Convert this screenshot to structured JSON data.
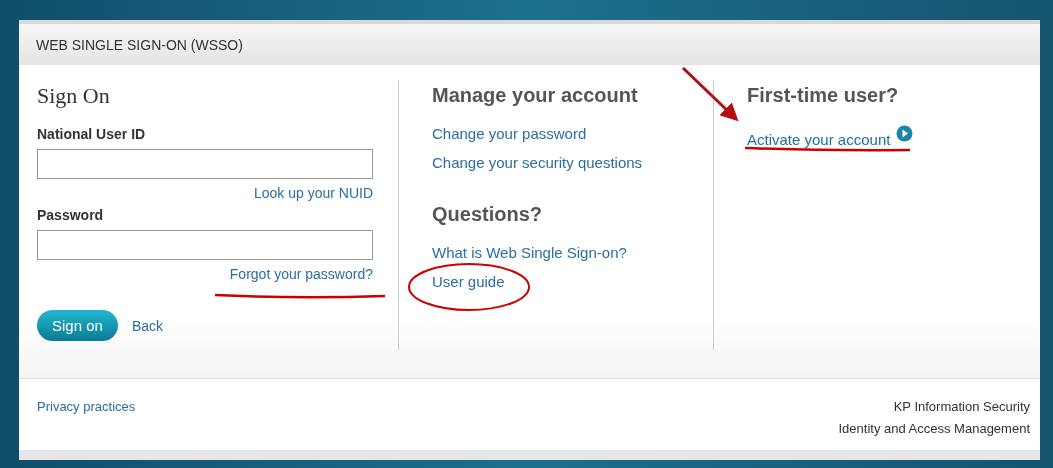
{
  "header": {
    "title": "WEB SINGLE SIGN-ON (WSSO)"
  },
  "sign_on": {
    "title": "Sign On",
    "fields": [
      {
        "label": "National User ID",
        "link": "Look up your NUID"
      },
      {
        "label": "Password",
        "link": "Forgot your password?"
      }
    ],
    "submit_button": "Sign on",
    "back_link": "Back"
  },
  "manage": {
    "title": "Manage your account",
    "links": [
      "Change your password",
      "Change your security questions"
    ]
  },
  "questions": {
    "title": "Questions?",
    "links": [
      "What is Web Single Sign-on?",
      "User guide"
    ]
  },
  "first_time": {
    "title": "First-time user?",
    "link": "Activate your account"
  },
  "footer": {
    "left_link": "Privacy practices",
    "right_lines": [
      "KP Information Security",
      "Identity and Access Management"
    ]
  }
}
